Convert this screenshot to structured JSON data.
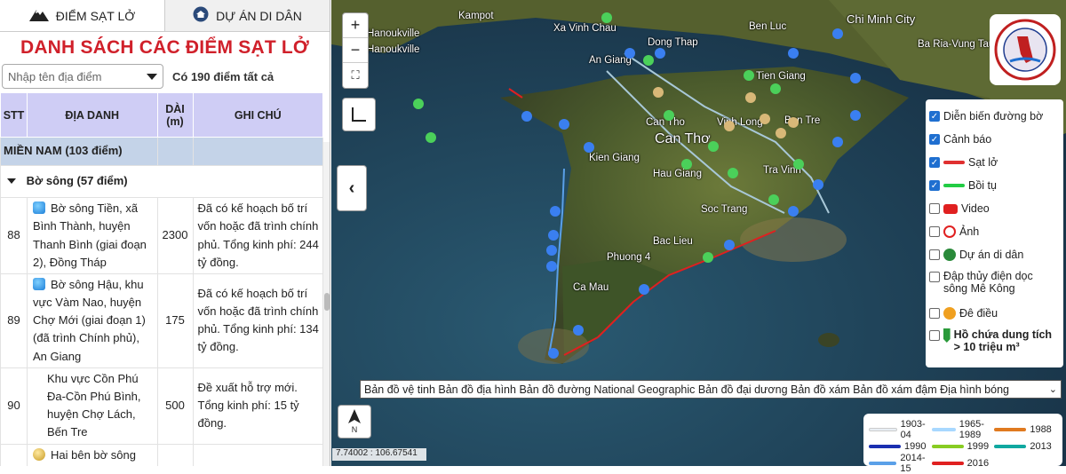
{
  "tabs": [
    {
      "label": "ĐIỂM SẠT LỞ",
      "icon": "mountain-icon",
      "active": true
    },
    {
      "label": "DỰ ÁN DI DÂN",
      "icon": "home-icon",
      "active": false
    }
  ],
  "list": {
    "title": "DANH SÁCH CÁC ĐIỂM SẠT LỞ",
    "search_placeholder": "Nhập tên địa điểm",
    "count_text": "Có 190 điểm tất cả",
    "columns": [
      "STT",
      "ĐỊA DANH",
      "DÀI (m)",
      "GHI CHÚ"
    ],
    "region": "MIỀN NAM (103 điểm)",
    "group": "Bờ sông (57 điểm)",
    "rows": [
      {
        "stt": "88",
        "name": "Bờ sông Tiền, xã Bình Thành, huyện Thanh Bình (giai đoạn 2), Đồng Tháp",
        "length": "2300",
        "note": "Đã có kế hoạch bố trí vốn hoặc đã trình chính phủ. Tổng kinh phí: 244 tỷ đồng.",
        "icon": "blue-info-icon"
      },
      {
        "stt": "89",
        "name": "Bờ sông Hậu, khu vực Vàm Nao, huyện Chợ Mới (giai đoạn 1) (đã trình Chính phủ), An Giang",
        "length": "175",
        "note": "Đã có kế hoạch bố trí vốn hoặc đã trình chính phủ. Tổng kinh phí: 134 tỷ đồng.",
        "icon": "blue-info-icon"
      },
      {
        "stt": "90",
        "name": "Khu vực Cồn Phú Đa-Cồn Phú Bình, huyện Chợ Lách, Bến Tre",
        "length": "500",
        "note": "Đề xuất hỗ trợ mới. Tổng kinh phí: 15 tỷ đồng.",
        "icon": ""
      },
      {
        "stt": "",
        "name": "Hai bên bờ sông Mỏ",
        "length": "",
        "note": "",
        "icon": "gold-info-icon"
      }
    ]
  },
  "map": {
    "zoom_in": "+",
    "zoom_out": "−",
    "coords": "7.74002 : 106.67541",
    "north_label": "N",
    "place_labels": [
      {
        "name": "Kampot"
      },
      {
        "name": "Xa Vinh Chau"
      },
      {
        "name": "Chi Minh City"
      },
      {
        "name": "Hanoukville"
      },
      {
        "name": "Hanoukville"
      },
      {
        "name": "Dong Thap"
      },
      {
        "name": "An Giang"
      },
      {
        "name": "Ben Luc"
      },
      {
        "name": "Ba Ria-Vung Tau"
      },
      {
        "name": "Tien Giang"
      },
      {
        "name": "Can Tho"
      },
      {
        "name": "Vinh Long"
      },
      {
        "name": "Ben Tre"
      },
      {
        "name": "Can Thơ"
      },
      {
        "name": "Kien Giang"
      },
      {
        "name": "Hau Giang"
      },
      {
        "name": "Tra Vinh"
      },
      {
        "name": "Soc Trang"
      },
      {
        "name": "Bac Lieu"
      },
      {
        "name": "Phuong 4"
      },
      {
        "name": "Ca Mau"
      }
    ],
    "layers": [
      {
        "label": "Diễn biến đường bờ",
        "checked": true,
        "swatch": ""
      },
      {
        "label": "Cảnh báo",
        "checked": true,
        "swatch": ""
      },
      {
        "label": "Sạt lở",
        "checked": true,
        "swatch": "#e03030"
      },
      {
        "label": "Bồi tụ",
        "checked": true,
        "swatch": "#22cc44"
      },
      {
        "label": "Video",
        "checked": false,
        "swatch": "video-icon"
      },
      {
        "label": "Ảnh",
        "checked": false,
        "swatch": "camera-icon"
      },
      {
        "label": "Dự án di dân",
        "checked": false,
        "swatch": "relocation-icon"
      },
      {
        "label": "Đập thủy điện dọc sông Mê Kông",
        "checked": false,
        "swatch": ""
      },
      {
        "label": "Đê điều",
        "checked": false,
        "swatch": "dyke-icon"
      },
      {
        "label": "Hồ chứa dung tích > 10 triệu m³",
        "checked": false,
        "swatch": "reservoir-icon"
      }
    ],
    "basemap_select": "Bản đồ vệ tinh Bản đồ địa hình Bản đồ đường National Geographic Bản đồ đại dương Bản đồ xám Bản đồ xám đậm Địa hình bóng",
    "legend": [
      {
        "label": "1903-04",
        "color": "#e8eef4"
      },
      {
        "label": "1965-1989",
        "color": "#a8d8ff"
      },
      {
        "label": "1988",
        "color": "#e07a20"
      },
      {
        "label": "1990",
        "color": "#1a2fb0"
      },
      {
        "label": "1999",
        "color": "#88cc22"
      },
      {
        "label": "2013",
        "color": "#10a8a0"
      },
      {
        "label": "2014-15",
        "color": "#5aa0e8"
      },
      {
        "label": "2016",
        "color": "#e02020"
      }
    ]
  }
}
